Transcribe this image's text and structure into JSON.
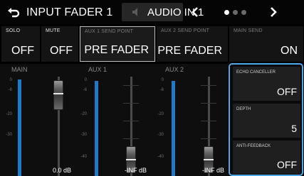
{
  "header": {
    "title": "INPUT FADER 1",
    "channel": "AUDIO IN 1",
    "icons": {
      "back": "return-arrow-icon",
      "prev": "chevron-left-icon",
      "next": "chevron-right-icon"
    },
    "page_count": 3,
    "active_page": 1
  },
  "params": [
    {
      "label": "SOLO",
      "value": "OFF"
    },
    {
      "label": "MUTE",
      "value": "OFF"
    },
    {
      "label": "AUX 1 SEND POINT",
      "value": "PRE FADER"
    },
    {
      "label": "AUX 2 SEND POINT",
      "value": "PRE FADER"
    },
    {
      "label": "MAIN SEND",
      "value": "ON"
    }
  ],
  "faders": [
    {
      "label": "MAIN",
      "value": "0.0 dB"
    },
    {
      "label": "AUX 1",
      "value": "-INF dB"
    },
    {
      "label": "AUX 2",
      "value": "-INF dB"
    }
  ],
  "scale": [
    "0",
    "-6",
    "-10",
    "-20",
    "-30",
    "-40"
  ],
  "side_panel": [
    {
      "label": "ECHO CANCELLER",
      "value": "OFF"
    },
    {
      "label": "DEPTH",
      "value": "5"
    },
    {
      "label": "ANTI-FEEDBACK",
      "value": "OFF"
    }
  ],
  "colors": {
    "accent": "#4fa8e8",
    "meter": "#1f79c7"
  }
}
